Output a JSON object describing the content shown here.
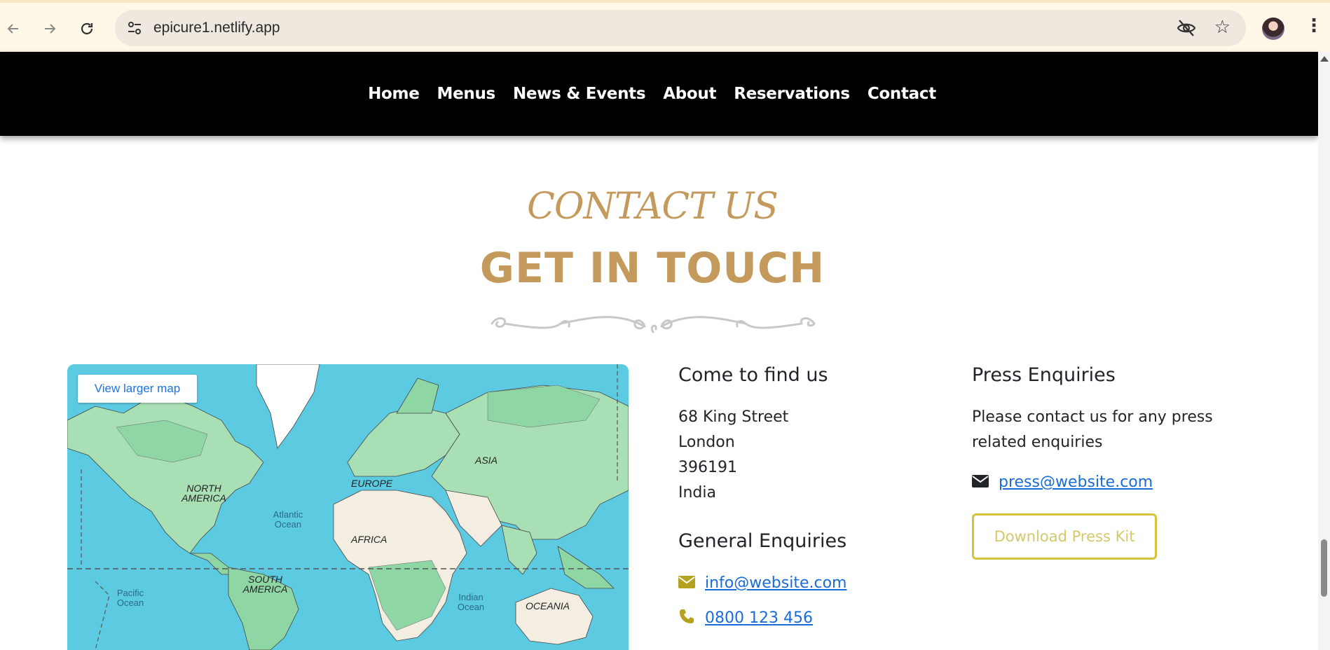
{
  "browser": {
    "url": "epicure1.netlify.app",
    "back_icon": "back-arrow-icon",
    "forward_icon": "forward-arrow-icon",
    "reload_icon": "reload-icon"
  },
  "nav": {
    "items": [
      "Home",
      "Menus",
      "News & Events",
      "About",
      "Reservations",
      "Contact"
    ]
  },
  "header": {
    "kicker": "CONTACT US",
    "title": "GET IN TOUCH"
  },
  "map": {
    "larger_map_label": "View larger map",
    "labels": {
      "north_america": "NORTH AMERICA",
      "europe": "EUROPE",
      "asia": "ASIA",
      "africa": "AFRICA",
      "south_america": "SOUTH AMERICA",
      "oceania": "OCEANIA",
      "atlantic": "Atlantic Ocean",
      "pacific": "Pacific Ocean",
      "indian": "Indian Ocean"
    }
  },
  "find_us": {
    "title": "Come to find us",
    "address": [
      "68 King Street",
      "London",
      "396191",
      "India"
    ]
  },
  "general": {
    "title": "General Enquiries",
    "email": "info@website.com",
    "phone": "0800 123 456"
  },
  "press": {
    "title": "Press Enquiries",
    "text": [
      "Please contact us for any press",
      "related enquiries"
    ],
    "email": "press@website.com",
    "button": "Download Press Kit"
  },
  "colors": {
    "gold": "#c49a5c",
    "accent_olive": "#b5a21e",
    "link": "#1a6cd8",
    "nav_bg": "#000000"
  }
}
